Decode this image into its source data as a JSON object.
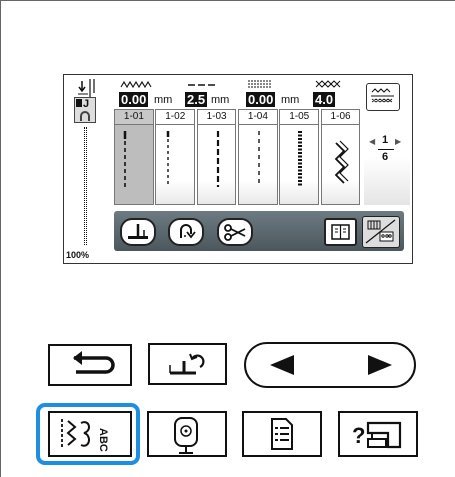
{
  "status": {
    "width_value": "0.00",
    "length_value": "2.5",
    "width2_value": "0.00",
    "tension_value": "4.0",
    "unit_mm": "mm",
    "zoom": "100%",
    "foot_letter": "J"
  },
  "tabs": [
    "1-01",
    "1-02",
    "1-03",
    "1-04",
    "1-05",
    "1-06"
  ],
  "selected_tab": "1-01",
  "page": {
    "current": "1",
    "total": "6"
  },
  "hardware": {
    "back_icon": "back-arrow-icon",
    "presser_foot_icon": "presser-foot-rotate-icon",
    "prev_icon": "left-triangle-icon",
    "next_icon": "right-triangle-icon",
    "utility_icon": "utility-stitch-icon",
    "embroidery_icon": "embroidery-icon",
    "settings_icon": "settings-list-icon",
    "help_icon": "help-machine-icon"
  },
  "colors": {
    "highlight": "#1e8fe0",
    "toolbar": "#5a666d"
  }
}
